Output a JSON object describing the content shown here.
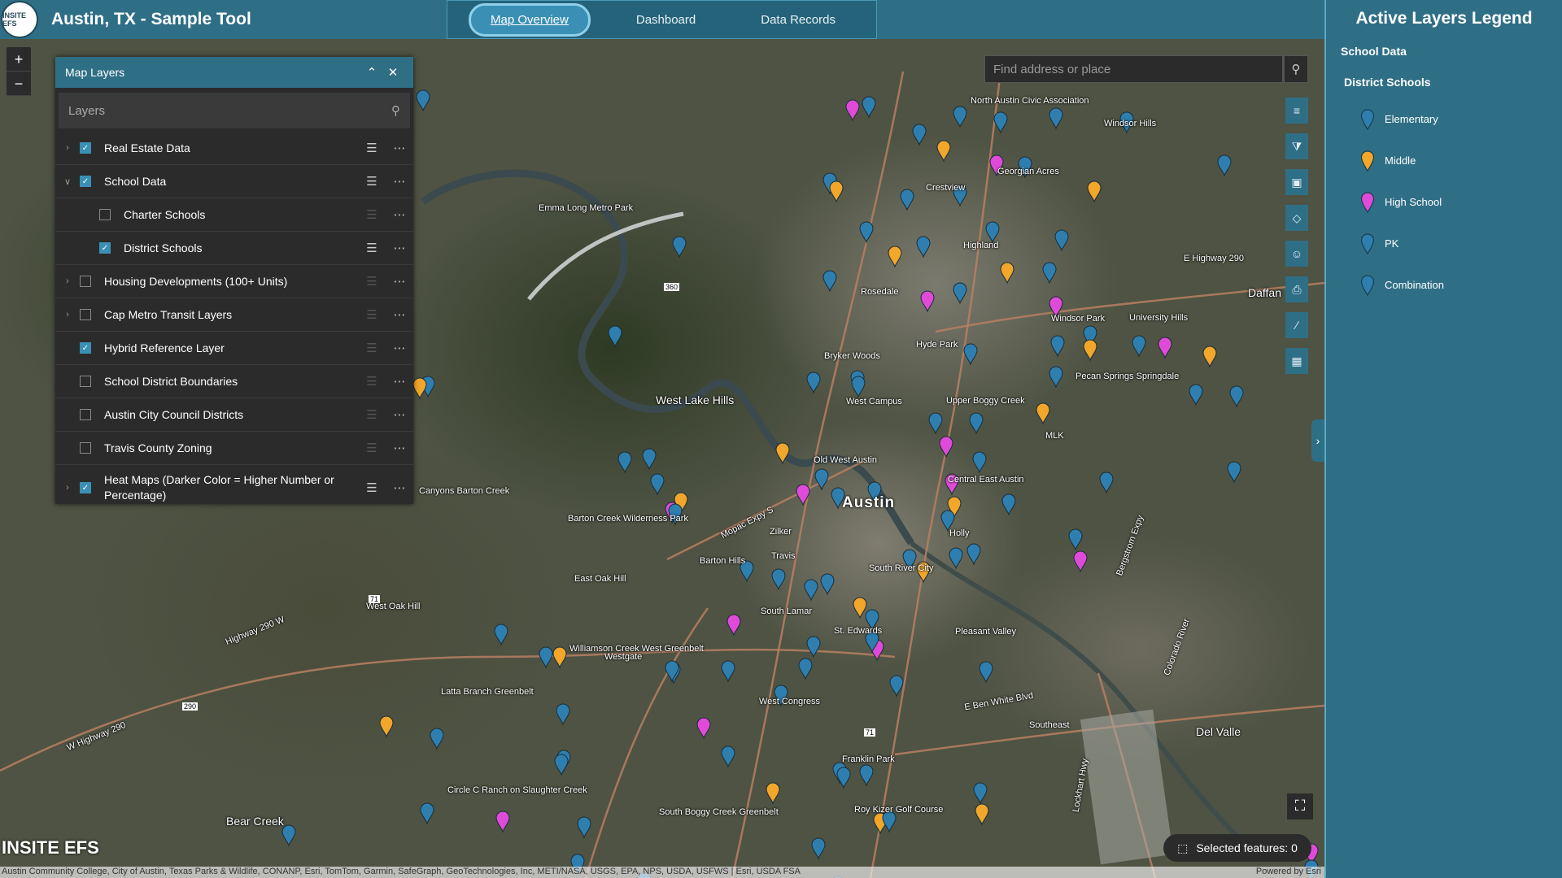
{
  "header": {
    "logo_text": "INSITE EFS",
    "title": "Austin, TX - Sample Tool",
    "tabs": [
      {
        "label": "Map Overview",
        "active": true
      },
      {
        "label": "Dashboard",
        "active": false
      },
      {
        "label": "Data Records",
        "active": false
      }
    ]
  },
  "zoom": {
    "in": "+",
    "out": "−"
  },
  "layers_panel": {
    "title": "Map Layers",
    "search_placeholder": "Layers",
    "layers": [
      {
        "name": "Real Estate Data",
        "checked": true,
        "expandable": true,
        "expanded": false,
        "indent": false,
        "legend": true
      },
      {
        "name": "School Data",
        "checked": true,
        "expandable": true,
        "expanded": true,
        "indent": false,
        "legend": true
      },
      {
        "name": "Charter Schools",
        "checked": false,
        "expandable": false,
        "indent": true,
        "legend": false
      },
      {
        "name": "District Schools",
        "checked": true,
        "expandable": false,
        "indent": true,
        "legend": true
      },
      {
        "name": "Housing Developments (100+ Units)",
        "checked": false,
        "expandable": true,
        "expanded": false,
        "indent": false,
        "legend": false
      },
      {
        "name": "Cap Metro Transit Layers",
        "checked": false,
        "expandable": true,
        "expanded": false,
        "indent": false,
        "legend": false
      },
      {
        "name": "Hybrid Reference Layer",
        "checked": true,
        "expandable": false,
        "indent": false,
        "legend": false
      },
      {
        "name": "School District Boundaries",
        "checked": false,
        "expandable": false,
        "indent": false,
        "legend": false
      },
      {
        "name": "Austin City Council Districts",
        "checked": false,
        "expandable": false,
        "indent": false,
        "legend": false
      },
      {
        "name": "Travis County Zoning",
        "checked": false,
        "expandable": false,
        "indent": false,
        "legend": false
      },
      {
        "name": "Heat Maps (Darker Color = Higher Number or Percentage)",
        "checked": true,
        "expandable": true,
        "expanded": false,
        "indent": false,
        "legend": true
      }
    ]
  },
  "map_search": {
    "placeholder": "Find address or place"
  },
  "map_labels": [
    {
      "text": "Austin",
      "size": "big"
    },
    {
      "text": "West Lake Hills",
      "size": "med"
    },
    {
      "text": "Emma Long Metro Park"
    },
    {
      "text": "Barton Creek Wilderness Park"
    },
    {
      "text": "Barton Hills"
    },
    {
      "text": "Zilker"
    },
    {
      "text": "Travis"
    },
    {
      "text": "East Oak Hill"
    },
    {
      "text": "West Oak Hill"
    },
    {
      "text": "Highway 290 W"
    },
    {
      "text": "Williamson Creek West Greenbelt"
    },
    {
      "text": "Latta Branch Greenbelt"
    },
    {
      "text": "Circle C Ranch on Slaughter Creek"
    },
    {
      "text": "South Boggy Creek Greenbelt"
    },
    {
      "text": "Bear Creek",
      "size": "med"
    },
    {
      "text": "Del Valle",
      "size": "med"
    },
    {
      "text": "Hyde Park"
    },
    {
      "text": "Rosedale"
    },
    {
      "text": "Crestview"
    },
    {
      "text": "Highland"
    },
    {
      "text": "Georgian Acres"
    },
    {
      "text": "North Austin Civic Association"
    },
    {
      "text": "Windsor Hills"
    },
    {
      "text": "Windsor Park"
    },
    {
      "text": "University Hills"
    },
    {
      "text": "Pecan Springs Springdale"
    },
    {
      "text": "MLK"
    },
    {
      "text": "Upper Boggy Creek"
    },
    {
      "text": "Holly"
    },
    {
      "text": "South River City"
    },
    {
      "text": "St. Edwards"
    },
    {
      "text": "Pleasant Valley"
    },
    {
      "text": "Westgate"
    },
    {
      "text": "West Congress"
    },
    {
      "text": "Franklin Park"
    },
    {
      "text": "Roy Kizer Golf Course"
    },
    {
      "text": "Southeast"
    },
    {
      "text": "E Ben White Blvd"
    },
    {
      "text": "E Highway 290"
    },
    {
      "text": "Daffan",
      "size": "med"
    },
    {
      "text": "West Campus"
    },
    {
      "text": "Bryker Woods"
    },
    {
      "text": "Mopac Expy S"
    },
    {
      "text": "Canyons Barton Creek"
    },
    {
      "text": "W Highway 290"
    },
    {
      "text": "Colorado River"
    },
    {
      "text": "Lockhart Hwy"
    },
    {
      "text": "Bergstrom Expy"
    },
    {
      "text": "South Lamar"
    },
    {
      "text": "Old West Austin"
    },
    {
      "text": "Central East Austin"
    }
  ],
  "road_shields": [
    "360",
    "71",
    "290",
    "71"
  ],
  "toolbar": [
    {
      "icon": "layers-icon"
    },
    {
      "icon": "filter-icon"
    },
    {
      "icon": "save-icon"
    },
    {
      "icon": "directions-icon"
    },
    {
      "icon": "person-icon"
    },
    {
      "icon": "print-icon"
    },
    {
      "icon": "measure-icon"
    },
    {
      "icon": "grid-icon"
    }
  ],
  "selected_features": "Selected features: 0",
  "brand": "INSITE EFS",
  "attribution": "Austin Community College, City of Austin, Texas Parks & Wildlife, CONANP, Esri, TomTom, Garmin, SafeGraph, GeoTechnologies, Inc, METI/NASA, USGS, EPA, NPS, USDA, USFWS | Esri, USDA FSA",
  "powered_by": "Powered by Esri",
  "legend": {
    "title": "Active Layers Legend",
    "group": "School Data",
    "subgroup": "District Schools",
    "items": [
      {
        "label": "Elementary",
        "color": "#2e7fb0"
      },
      {
        "label": "Middle",
        "color": "#f2a62a"
      },
      {
        "label": "High School",
        "color": "#e04ad8"
      },
      {
        "label": "PK",
        "color": "#2e7fb0"
      },
      {
        "label": "Combination",
        "color": "#2e7fb0"
      }
    ]
  },
  "colors": {
    "header": "#2f6f86",
    "panel": "#2b2b2b",
    "elementary": "#2e7fb0",
    "middle": "#f2a62a",
    "high_school": "#e04ad8"
  }
}
